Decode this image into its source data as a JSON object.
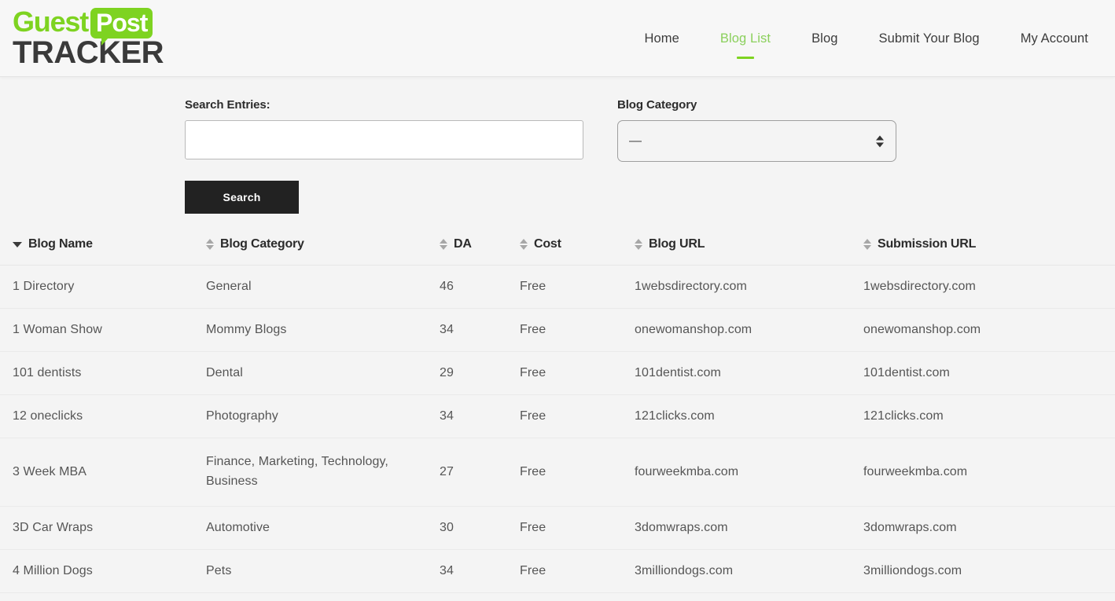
{
  "brand": {
    "word1": "Guest",
    "word2": "Post",
    "word3": "TRACKER",
    "green": "#7ED321",
    "dark": "#3a3a3a"
  },
  "nav": {
    "items": [
      {
        "label": "Home",
        "active": false
      },
      {
        "label": "Blog List",
        "active": true
      },
      {
        "label": "Blog",
        "active": false
      },
      {
        "label": "Submit Your Blog",
        "active": false
      },
      {
        "label": "My Account",
        "active": false
      }
    ],
    "active_color": "#8BD05C"
  },
  "filters": {
    "search_label": "Search Entries:",
    "search_value": "",
    "search_placeholder": "",
    "category_label": "Blog Category",
    "category_selected": "—",
    "search_button": "Search"
  },
  "table": {
    "columns": [
      {
        "label": "Blog Name",
        "sort": "desc"
      },
      {
        "label": "Blog Category",
        "sort": "none"
      },
      {
        "label": "DA",
        "sort": "none"
      },
      {
        "label": "Cost",
        "sort": "none"
      },
      {
        "label": "Blog URL",
        "sort": "none"
      },
      {
        "label": "Submission URL",
        "sort": "none"
      }
    ],
    "rows": [
      {
        "name": "1 Directory",
        "category": "General",
        "da": "46",
        "cost": "Free",
        "blog_url": "1websdirectory.com",
        "submission_url": "1websdirectory.com"
      },
      {
        "name": "1 Woman Show",
        "category": "Mommy Blogs",
        "da": "34",
        "cost": "Free",
        "blog_url": "onewomanshop.com",
        "submission_url": "onewomanshop.com"
      },
      {
        "name": "101 dentists",
        "category": "Dental",
        "da": "29",
        "cost": "Free",
        "blog_url": "101dentist.com",
        "submission_url": "101dentist.com"
      },
      {
        "name": "12 oneclicks",
        "category": "Photography",
        "da": "34",
        "cost": "Free",
        "blog_url": "121clicks.com",
        "submission_url": "121clicks.com"
      },
      {
        "name": "3 Week MBA",
        "category": "Finance, Marketing, Technology, Business",
        "da": "27",
        "cost": "Free",
        "blog_url": "fourweekmba.com",
        "submission_url": "fourweekmba.com"
      },
      {
        "name": "3D Car Wraps",
        "category": "Automotive",
        "da": "30",
        "cost": "Free",
        "blog_url": "3domwraps.com",
        "submission_url": "3domwraps.com"
      },
      {
        "name": "4 Million Dogs",
        "category": "Pets",
        "da": "34",
        "cost": "Free",
        "blog_url": "3milliondogs.com",
        "submission_url": "3milliondogs.com"
      }
    ]
  }
}
